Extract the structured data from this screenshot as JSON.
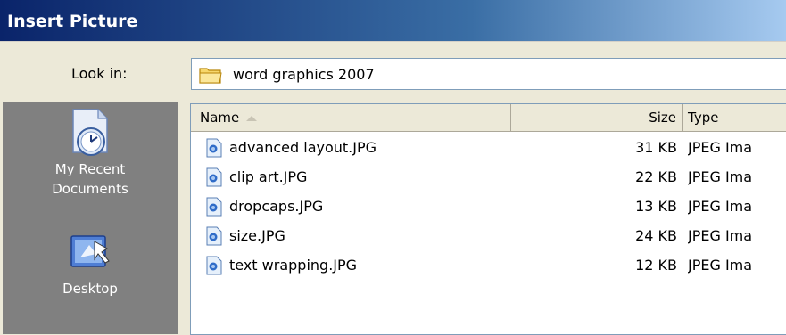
{
  "window": {
    "title": "Insert Picture"
  },
  "look_in": {
    "label": "Look in:",
    "value": "word graphics 2007",
    "icon": "folder-icon"
  },
  "places": [
    {
      "label_line1": "My Recent",
      "label_line2": "Documents",
      "icon": "recent-documents-icon"
    },
    {
      "label_line1": "Desktop",
      "label_line2": "",
      "icon": "desktop-icon"
    }
  ],
  "columns": {
    "name": "Name",
    "size": "Size",
    "type": "Type"
  },
  "files": [
    {
      "name": "advanced layout.JPG",
      "size": "31 KB",
      "type": "JPEG Ima"
    },
    {
      "name": "clip art.JPG",
      "size": "22 KB",
      "type": "JPEG Ima"
    },
    {
      "name": "dropcaps.JPG",
      "size": "13 KB",
      "type": "JPEG Ima"
    },
    {
      "name": "size.JPG",
      "size": "24 KB",
      "type": "JPEG Ima"
    },
    {
      "name": "text wrapping.JPG",
      "size": "12 KB",
      "type": "JPEG Ima"
    }
  ],
  "colors": {
    "title_start": "#0a246a",
    "title_end": "#a6caf0",
    "dialog_bg": "#ece9d8",
    "places_bg": "#808080"
  }
}
